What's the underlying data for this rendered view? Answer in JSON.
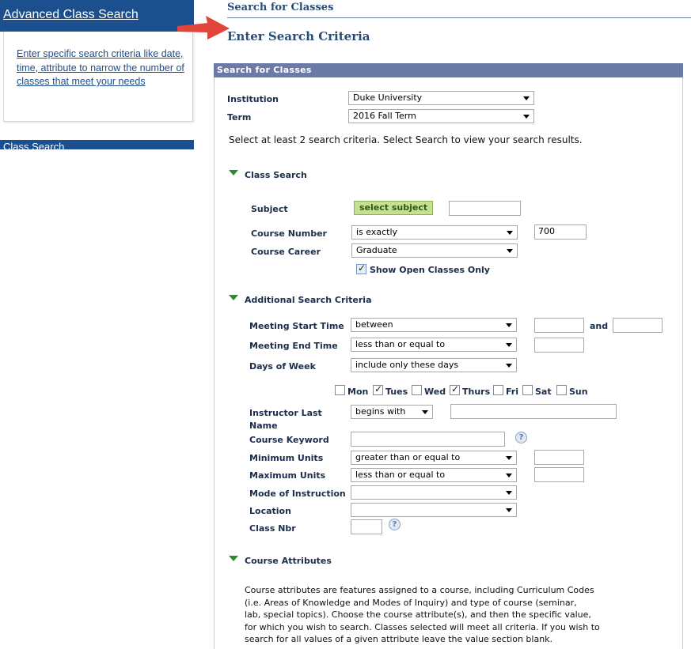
{
  "sidebar": {
    "header_title": "Advanced Class Search",
    "description": "Enter specific search criteria like date, time, attribute to narrow the number of classes that meet your needs",
    "header2_title": "Class Search"
  },
  "page": {
    "title": "Search for Classes",
    "subtitle": "Enter Search Criteria"
  },
  "panel": {
    "title": "Search for Classes",
    "institution_label": "Institution",
    "institution_value": "Duke University",
    "term_label": "Term",
    "term_value": "2016 Fall Term",
    "instructions": "Select at least 2 search criteria. Select Search to view your search results."
  },
  "class_search": {
    "section_label": "Class Search",
    "subject_label": "Subject",
    "select_subject_button": "select subject",
    "subject_value": "",
    "course_number_label": "Course Number",
    "course_number_operator": "is exactly",
    "course_number_value": "700",
    "course_career_label": "Course Career",
    "course_career_value": "Graduate",
    "open_only_label": "Show Open Classes Only",
    "open_only_checked": true
  },
  "additional": {
    "section_label": "Additional Search Criteria",
    "start_time_label": "Meeting Start Time",
    "start_time_operator": "between",
    "start_time_value1": "",
    "and_label": "and",
    "start_time_value2": "",
    "end_time_label": "Meeting End Time",
    "end_time_operator": "less than or equal to",
    "end_time_value": "",
    "days_label": "Days of Week",
    "days_operator": "include only these days",
    "days": [
      {
        "label": "Mon",
        "checked": false
      },
      {
        "label": "Tues",
        "checked": true
      },
      {
        "label": "Wed",
        "checked": false
      },
      {
        "label": "Thurs",
        "checked": true
      },
      {
        "label": "Fri",
        "checked": false
      },
      {
        "label": "Sat",
        "checked": false
      },
      {
        "label": "Sun",
        "checked": false
      }
    ],
    "instructor_label_line1": "Instructor Last",
    "instructor_label_line2": "Name",
    "instructor_operator": "begins with",
    "instructor_value": "",
    "keyword_label": "Course Keyword",
    "keyword_value": "",
    "help_glyph": "?",
    "min_units_label": "Minimum Units",
    "min_units_operator": "greater than or equal to",
    "min_units_value": "",
    "max_units_label": "Maximum Units",
    "max_units_operator": "less than or equal to",
    "max_units_value": "",
    "mode_label": "Mode of Instruction",
    "mode_value": "",
    "location_label": "Location",
    "location_value": "",
    "class_nbr_label": "Class Nbr",
    "class_nbr_value": ""
  },
  "attributes": {
    "section_label": "Course Attributes",
    "lines": [
      "Course attributes are features assigned to a course, including Curriculum Codes",
      "(i.e. Areas of Knowledge and Modes of Inquiry) and type of course (seminar,",
      "lab, special topics). Choose the course attribute(s), and then the specific value,",
      "for which you wish to search. Classes selected will meet all criteria. If you wish to",
      "search for all values of a given attribute leave the value section blank."
    ]
  },
  "colors": {
    "sidebar_blue": "#1c4f8e",
    "panel_bar": "#6b7ba5",
    "heading": "#2a4d78",
    "arrow": "#e0443a",
    "button_green": "#c6e08f"
  },
  "icons": {
    "arrow": "red-arrow-icon",
    "expand": "triangle-down-icon",
    "help": "help-icon",
    "dropdown": "chevron-down-icon"
  }
}
